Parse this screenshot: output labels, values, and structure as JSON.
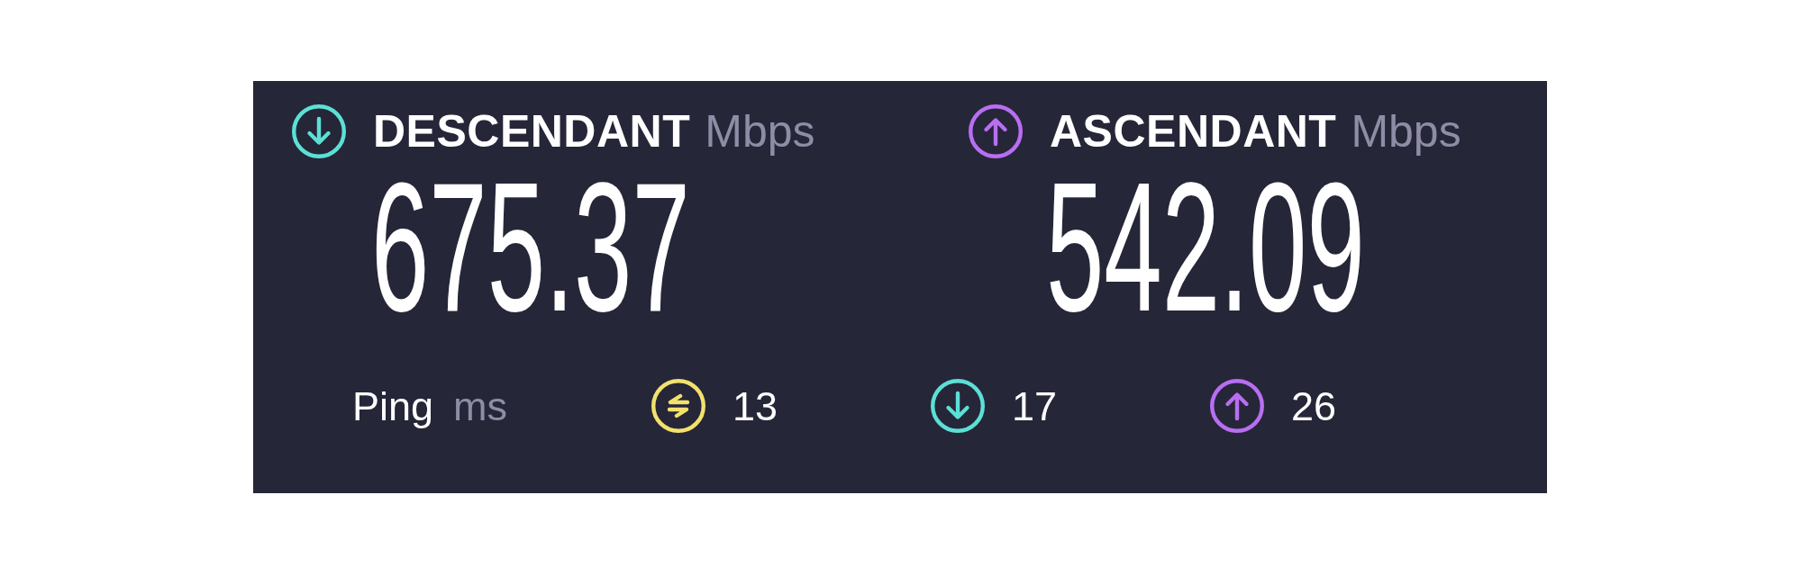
{
  "results": [
    {
      "kind": "download",
      "label": "DESCENDANT",
      "unit": "Mbps",
      "value": "675.37",
      "color": "#5ce0d6"
    },
    {
      "kind": "upload",
      "label": "ASCENDANT",
      "unit": "Mbps",
      "value": "542.09",
      "color": "#b86ef2"
    }
  ],
  "ping": {
    "label": "Ping",
    "unit": "ms",
    "readings": [
      {
        "kind": "idle",
        "value": "13",
        "color": "#f2e26d"
      },
      {
        "kind": "download",
        "value": "17",
        "color": "#5ce0d6"
      },
      {
        "kind": "upload",
        "value": "26",
        "color": "#b86ef2"
      }
    ]
  }
}
